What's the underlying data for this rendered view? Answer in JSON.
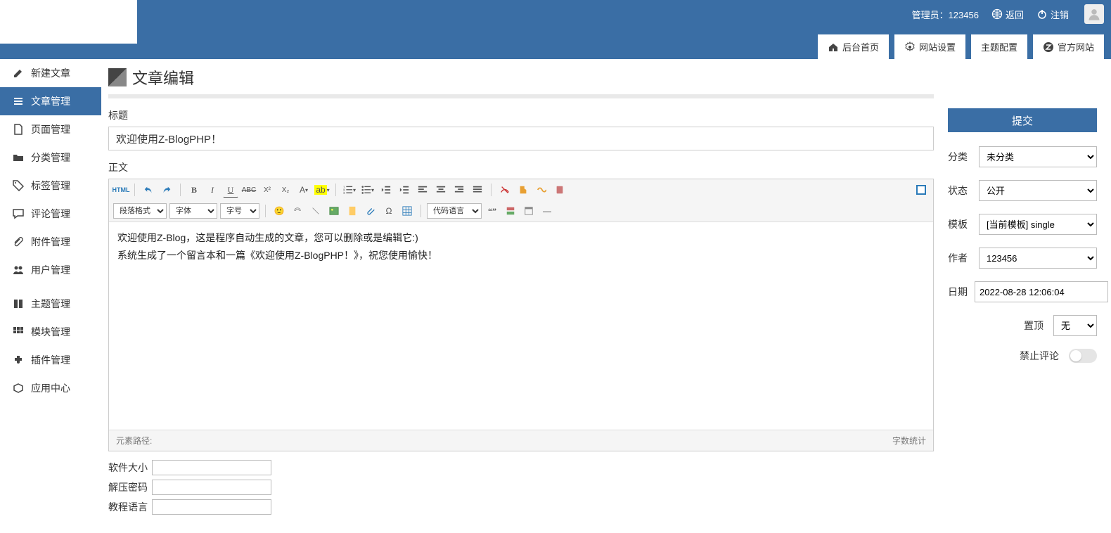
{
  "header": {
    "admin_label": "管理员：123456",
    "back": "返回",
    "logout": "注销",
    "tabs": [
      {
        "icon": "home",
        "label": "后台首页"
      },
      {
        "icon": "gear",
        "label": "网站设置"
      },
      {
        "icon": "none",
        "label": "主题配置"
      },
      {
        "icon": "globe",
        "label": "官方网站"
      }
    ]
  },
  "sidebar": {
    "items": [
      {
        "icon": "edit",
        "label": "新建文章"
      },
      {
        "icon": "list",
        "label": "文章管理",
        "active": true
      },
      {
        "icon": "page",
        "label": "页面管理"
      },
      {
        "icon": "folder",
        "label": "分类管理"
      },
      {
        "icon": "tag",
        "label": "标签管理"
      },
      {
        "icon": "comment",
        "label": "评论管理"
      },
      {
        "icon": "attach",
        "label": "附件管理"
      },
      {
        "icon": "user",
        "label": "用户管理"
      },
      {
        "icon": "theme",
        "label": "主题管理"
      },
      {
        "icon": "module",
        "label": "模块管理"
      },
      {
        "icon": "plugin",
        "label": "插件管理"
      },
      {
        "icon": "app",
        "label": "应用中心"
      }
    ]
  },
  "page": {
    "title": "文章编辑",
    "field_title_label": "标题",
    "field_title_value": "欢迎使用Z-BlogPHP！",
    "field_body_label": "正文",
    "body_line1": "欢迎使用Z-Blog，这是程序自动生成的文章，您可以删除或是编辑它:)",
    "body_line2": "系统生成了一个留言本和一篇《欢迎使用Z-BlogPHP！》，祝您使用愉快！",
    "footer_path": "元素路径:",
    "footer_count": "字数统计",
    "extra": [
      {
        "label": "软件大小",
        "value": ""
      },
      {
        "label": "解压密码",
        "value": ""
      },
      {
        "label": "教程语言",
        "value": ""
      }
    ]
  },
  "toolbar": {
    "html": "HTML",
    "para": "段落格式",
    "font": "字体",
    "size": "字号",
    "codelang": "代码语言"
  },
  "right": {
    "submit": "提交",
    "category_label": "分类",
    "category_value": "未分类",
    "status_label": "状态",
    "status_value": "公开",
    "template_label": "模板",
    "template_value": "[当前模板] single",
    "author_label": "作者",
    "author_value": "123456",
    "date_label": "日期",
    "date_value": "2022-08-28 12:06:04",
    "sticky_label": "置顶",
    "sticky_value": "无",
    "nocomment_label": "禁止评论"
  }
}
